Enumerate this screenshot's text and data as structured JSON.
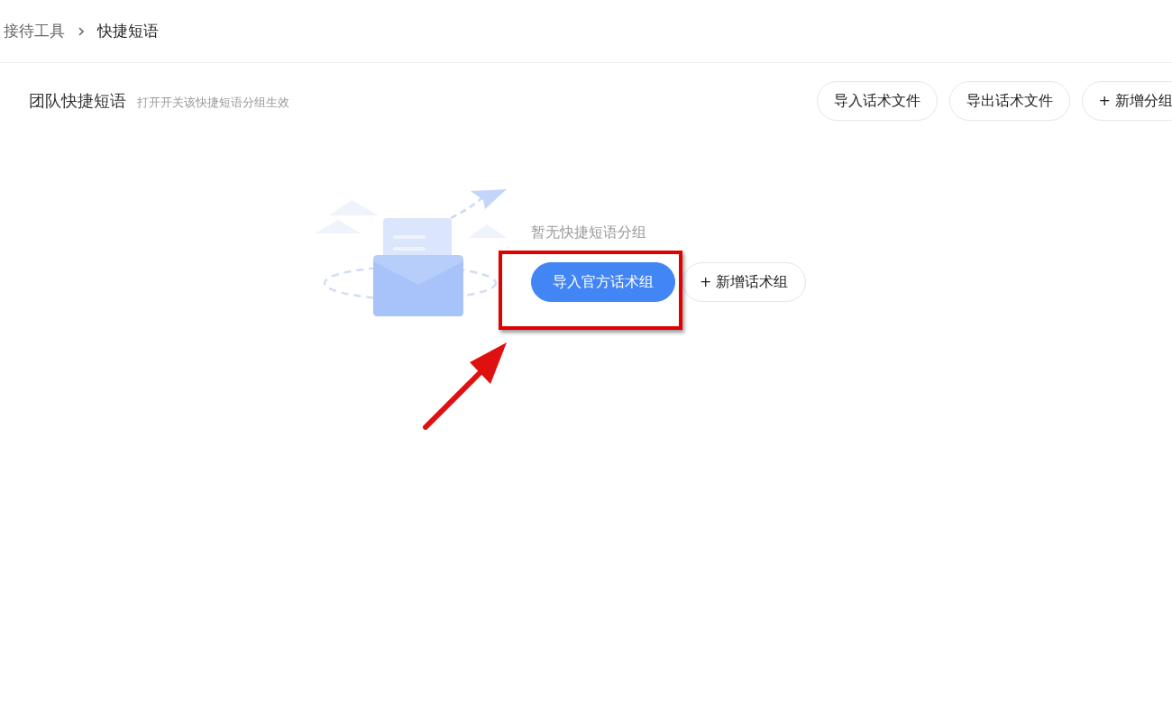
{
  "breadcrumb": [
    {
      "label": "接待工具",
      "selected": false
    },
    {
      "label": "快捷短语",
      "selected": true
    }
  ],
  "header": {
    "title": "团队快捷短语",
    "hint": "打开开关该快捷短语分组生效"
  },
  "actions": [
    {
      "label": "导入话术文件"
    },
    {
      "label": "导出话术文件"
    },
    {
      "label": "+ 新增分组"
    }
  ],
  "empty_state": {
    "message": "暂无快捷短语分组",
    "buttons": [
      {
        "label": "导入官方话术组",
        "kind": "primary"
      },
      {
        "label": "+ 新增话术组",
        "kind": "default"
      }
    ]
  }
}
